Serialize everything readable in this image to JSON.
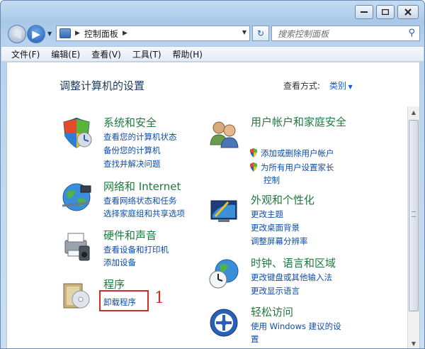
{
  "window": {
    "controls": {
      "minimize_icon": "minimize-icon",
      "maximize_icon": "maximize-icon",
      "close_icon": "close-icon"
    }
  },
  "nav": {
    "address_path": "控制面板",
    "search_placeholder": "搜索控制面板"
  },
  "menu": [
    "文件(F)",
    "编辑(E)",
    "查看(V)",
    "工具(T)",
    "帮助(H)"
  ],
  "main": {
    "title": "调整计算机的设置",
    "view_by_label": "查看方式:",
    "view_by_value": "类别"
  },
  "categories": {
    "system": {
      "title": "系统和安全",
      "links": [
        "查看您的计算机状态",
        "备份您的计算机",
        "查找并解决问题"
      ]
    },
    "network": {
      "title": "网络和 Internet",
      "links": [
        "查看网络状态和任务",
        "选择家庭组和共享选项"
      ]
    },
    "hardware": {
      "title": "硬件和声音",
      "links": [
        "查看设备和打印机",
        "添加设备"
      ]
    },
    "programs": {
      "title": "程序",
      "links": [
        "卸载程序"
      ]
    },
    "users": {
      "title": "用户帐户和家庭安全",
      "links": [
        "添加或删除用户帐户",
        "为所有用户设置家长",
        "控制"
      ]
    },
    "appearance": {
      "title": "外观和个性化",
      "links": [
        "更改主题",
        "更改桌面背景",
        "调整屏幕分辨率"
      ]
    },
    "clock": {
      "title": "时钟、语言和区域",
      "links": [
        "更改键盘或其他输入法",
        "更改显示语言"
      ]
    },
    "ease": {
      "title": "轻松访问",
      "links": [
        "使用 Windows 建议的设",
        "置"
      ]
    }
  },
  "annotation": {
    "number": "1",
    "color": "#d12b2b"
  }
}
